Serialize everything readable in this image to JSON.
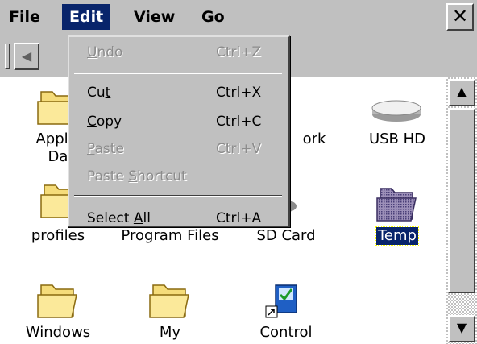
{
  "menubar": {
    "items": [
      {
        "pre": "",
        "ul": "F",
        "post": "ile"
      },
      {
        "pre": "",
        "ul": "E",
        "post": "dit"
      },
      {
        "pre": "",
        "ul": "V",
        "post": "iew"
      },
      {
        "pre": "",
        "ul": "G",
        "post": "o"
      }
    ],
    "close": "✕"
  },
  "toolbar": {
    "back": "◀"
  },
  "edit_menu": [
    {
      "pre": "",
      "ul": "U",
      "post": "ndo",
      "shortcut": "Ctrl+Z",
      "enabled": false
    },
    {
      "pre": "Cu",
      "ul": "t",
      "post": "",
      "shortcut": "Ctrl+X",
      "enabled": true
    },
    {
      "pre": "",
      "ul": "C",
      "post": "opy",
      "shortcut": "Ctrl+C",
      "enabled": true
    },
    {
      "pre": "",
      "ul": "P",
      "post": "aste",
      "shortcut": "Ctrl+V",
      "enabled": false
    },
    {
      "pre": "Paste ",
      "ul": "S",
      "post": "hortcut",
      "shortcut": "",
      "enabled": false
    },
    {
      "pre": "Select ",
      "ul": "A",
      "post": "ll",
      "shortcut": "Ctrl+A",
      "enabled": true
    }
  ],
  "files": [
    {
      "l1": "Applic",
      "l2": "Da",
      "icon": "folder-icon",
      "selected": false
    },
    {
      "l1": "ork",
      "l2": "",
      "icon": "network-icon",
      "selected": false
    },
    {
      "l1": "USB HD",
      "l2": "",
      "icon": "usb-drive-icon",
      "selected": false
    },
    {
      "l1": "profiles",
      "l2": "",
      "icon": "folder-icon",
      "selected": false
    },
    {
      "l1": "Program Files",
      "l2": "",
      "icon": "folder-icon",
      "selected": false
    },
    {
      "l1": "SD Card",
      "l2": "",
      "icon": "sd-card-icon",
      "selected": false
    },
    {
      "l1": "Temp",
      "l2": "",
      "icon": "folder-icon",
      "selected": true
    },
    {
      "l1": "Windows",
      "l2": "",
      "icon": "folder-icon",
      "selected": false
    },
    {
      "l1": "My",
      "l2": "",
      "icon": "folder-icon",
      "selected": false
    },
    {
      "l1": "Control",
      "l2": "",
      "icon": "control-panel-shortcut-icon",
      "selected": false
    }
  ],
  "scrollbar": {
    "up": "▲",
    "down": "▼"
  },
  "colors": {
    "chrome": "#c0c0c0",
    "highlight": "#08246b",
    "disabled_text": "#8c8c8c"
  }
}
